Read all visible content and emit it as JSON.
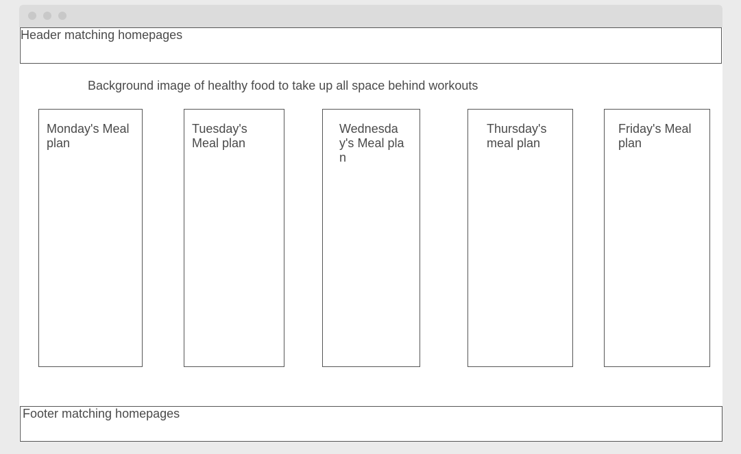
{
  "header": {
    "label": "Header matching homepages"
  },
  "background_note": "Background image of healthy food to take up all space behind workouts",
  "meal_plans": [
    {
      "label": "Monday's Meal plan"
    },
    {
      "label": "Tuesday's Meal plan"
    },
    {
      "label": "Wednesday's Meal plan"
    },
    {
      "label": "Thursday's meal plan"
    },
    {
      "label": "Friday's Meal plan"
    }
  ],
  "footer": {
    "label": "Footer matching homepages"
  }
}
